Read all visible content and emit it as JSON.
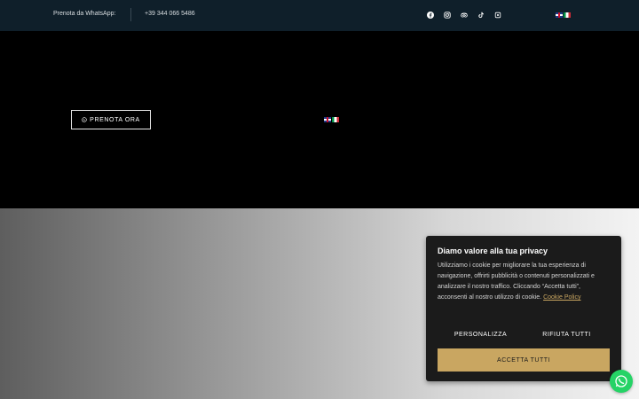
{
  "topbar": {
    "whatsapp_label": "Prenota da WhatsApp:",
    "phone": "+39 344 066 5486",
    "socials": [
      "facebook-icon",
      "instagram-icon",
      "tripadvisor-icon",
      "tiktok-icon",
      "foursquare-icon"
    ],
    "languages": [
      "uk-flag",
      "italy-flag"
    ]
  },
  "hero": {
    "cta_label": "PRENOTA ORA",
    "cta_icon": "whatsapp-icon",
    "languages": [
      "uk-flag",
      "italy-flag"
    ]
  },
  "cookie_banner": {
    "title": "Diamo valore alla tua privacy",
    "body": "Utilizziamo i cookie per migliorare la tua esperienza di navigazione, offrirti pubblicità o contenuti personalizzati e analizzare il nostro traffico. Cliccando “Accetta tutti”, acconsenti al nostro utilizzo di cookie.",
    "policy_link": "Cookie Policy",
    "customize_label": "PERSONALIZZA",
    "reject_label": "RIFIUTA TUTTI",
    "accept_label": "ACCETTA TUTTI"
  },
  "colors": {
    "topbar_bg": "#0f1f2a",
    "accent_gold": "#c9a661",
    "whatsapp_green": "#25d366"
  }
}
